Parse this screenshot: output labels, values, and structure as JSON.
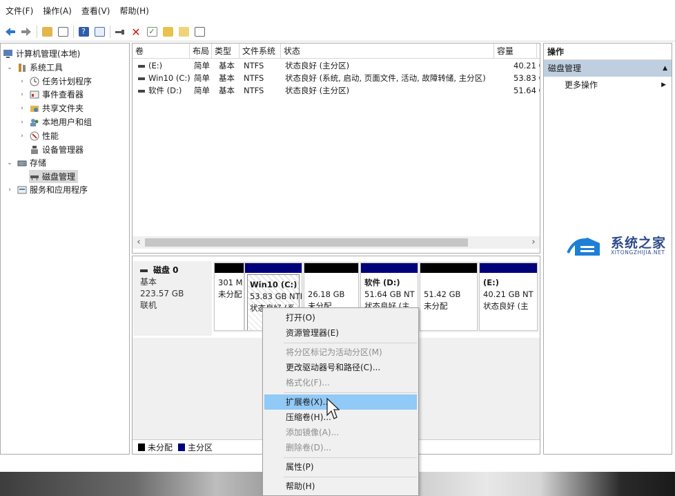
{
  "menubar": [
    "文件(F)",
    "操作(A)",
    "查看(V)",
    "帮助(H)"
  ],
  "toolbar": {
    "icons": [
      "back-arrow-icon",
      "forward-arrow-icon",
      "up-folder-icon",
      "show-hide-tree-icon",
      "help-icon",
      "properties-icon",
      "connect-icon",
      "delete-icon",
      "check-icon",
      "refresh-icon",
      "export-icon",
      "window-icon"
    ]
  },
  "tree": {
    "root": "计算机管理(本地)",
    "system_tools": "系统工具",
    "task_scheduler": "任务计划程序",
    "event_viewer": "事件查看器",
    "shared_folders": "共享文件夹",
    "local_users": "本地用户和组",
    "performance": "性能",
    "device_manager": "设备管理器",
    "storage": "存储",
    "disk_management": "磁盘管理",
    "services_apps": "服务和应用程序"
  },
  "volumes": {
    "headers": [
      "卷",
      "布局",
      "类型",
      "文件系统",
      "状态",
      "容量"
    ],
    "rows": [
      [
        "(E:)",
        "简单",
        "基本",
        "NTFS",
        "状态良好 (主分区)",
        "40.21 GB"
      ],
      [
        "Win10 (C:)",
        "简单",
        "基本",
        "NTFS",
        "状态良好 (系统, 启动, 页面文件, 活动, 故障转储, 主分区)",
        "53.83 GB"
      ],
      [
        "软件 (D:)",
        "简单",
        "基本",
        "NTFS",
        "状态良好 (主分区)",
        "51.64 GB"
      ]
    ]
  },
  "disk": {
    "name": "磁盘 0",
    "type": "基本",
    "size": "223.57 GB",
    "status": "联机",
    "partitions": [
      {
        "line1": "",
        "line2": "301 M",
        "line3": "未分配"
      },
      {
        "line1": "Win10 (C:)",
        "line2": "53.83 GB NTF",
        "line3": "状态良好 (系"
      },
      {
        "line1": "",
        "line2": "26.18 GB",
        "line3": "未分配"
      },
      {
        "line1": "软件 (D:)",
        "line2": "51.64 GB NT",
        "line3": "状态良好 (主"
      },
      {
        "line1": "",
        "line2": "51.42 GB",
        "line3": "未分配"
      },
      {
        "line1": "(E:)",
        "line2": "40.21 GB NT",
        "line3": "状态良好 (主"
      }
    ]
  },
  "legend": {
    "unallocated": "未分配",
    "primary": "主分区"
  },
  "actions": {
    "header": "操作",
    "section": "磁盘管理",
    "more": "更多操作"
  },
  "context_menu": {
    "open": "打开(O)",
    "explore": "资源管理器(E)",
    "mark_active": "将分区标记为活动分区(M)",
    "change_letter": "更改驱动器号和路径(C)...",
    "format": "格式化(F)...",
    "extend": "扩展卷(X)...",
    "shrink": "压缩卷(H)...",
    "add_mirror": "添加镜像(A)...",
    "delete": "删除卷(D)...",
    "properties": "属性(P)",
    "help": "帮助(H)"
  },
  "watermark": {
    "cn": "系统之家",
    "en": "XITONGZHIJIA.NET"
  },
  "colors": {
    "unallocated": "#000000",
    "primary": "#00007a",
    "selection": "#91c9f7",
    "action_section": "#bfcfe0",
    "watermark": "#2d4a8a"
  }
}
